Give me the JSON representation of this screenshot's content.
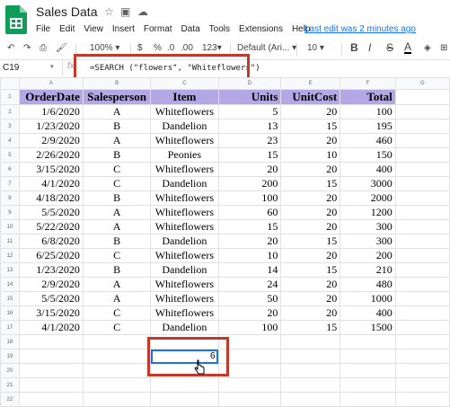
{
  "app": {
    "title": "Sales Data",
    "menu": [
      "File",
      "Edit",
      "View",
      "Insert",
      "Format",
      "Data",
      "Tools",
      "Extensions",
      "Help"
    ],
    "last_edit": "Last edit was 2 minutes ago"
  },
  "toolbar": {
    "zoom": "100%",
    "currency": "$",
    "percent": "%",
    "decimal_dec": ".0",
    "decimal_inc": ".00",
    "more_formats": "123",
    "font": "Default (Ari...",
    "font_size": "10",
    "bold": "B",
    "italic": "I",
    "strike": "S",
    "text_color": "A"
  },
  "formula_bar": {
    "cell_ref": "C19",
    "fx": "fx",
    "formula": "=SEARCH (\"flowers\", \"Whiteflowers\")"
  },
  "columns": [
    "",
    "A",
    "B",
    "C",
    "D",
    "E",
    "F",
    "G"
  ],
  "header": [
    "OrderDate",
    "Salesperson",
    "Item",
    "Units",
    "UnitCost",
    "Total"
  ],
  "rows": [
    [
      "1/6/2020",
      "A",
      "Whiteflowers",
      "5",
      "20",
      "100"
    ],
    [
      "1/23/2020",
      "B",
      "Dandelion",
      "13",
      "15",
      "195"
    ],
    [
      "2/9/2020",
      "A",
      "Whiteflowers",
      "23",
      "20",
      "460"
    ],
    [
      "2/26/2020",
      "B",
      "Peonies",
      "15",
      "10",
      "150"
    ],
    [
      "3/15/2020",
      "C",
      "Whiteflowers",
      "20",
      "20",
      "400"
    ],
    [
      "4/1/2020",
      "C",
      "Dandelion",
      "200",
      "15",
      "3000"
    ],
    [
      "4/18/2020",
      "B",
      "Whiteflowers",
      "100",
      "20",
      "2000"
    ],
    [
      "5/5/2020",
      "A",
      "Whiteflowers",
      "60",
      "20",
      "1200"
    ],
    [
      "5/22/2020",
      "A",
      "Whiteflowers",
      "15",
      "20",
      "300"
    ],
    [
      "6/8/2020",
      "B",
      "Dandelion",
      "20",
      "15",
      "300"
    ],
    [
      "6/25/2020",
      "C",
      "Whiteflowers",
      "10",
      "20",
      "200"
    ],
    [
      "1/23/2020",
      "B",
      "Dandelion",
      "14",
      "15",
      "210"
    ],
    [
      "2/9/2020",
      "A",
      "Whiteflowers",
      "24",
      "20",
      "480"
    ],
    [
      "5/5/2020",
      "A",
      "Whiteflowers",
      "50",
      "20",
      "1000"
    ],
    [
      "3/15/2020",
      "C",
      "Whiteflowers",
      "20",
      "20",
      "400"
    ],
    [
      "4/1/2020",
      "C",
      "Dandelion",
      "100",
      "15",
      "1500"
    ]
  ],
  "result_cell": {
    "value": "6"
  },
  "empty_rows": [
    "18",
    "20",
    "21",
    "22"
  ],
  "result_row": "19",
  "colors": {
    "header_fill": "#b4a7e5",
    "highlight": "#c0392b",
    "selection": "#1a73e8"
  }
}
